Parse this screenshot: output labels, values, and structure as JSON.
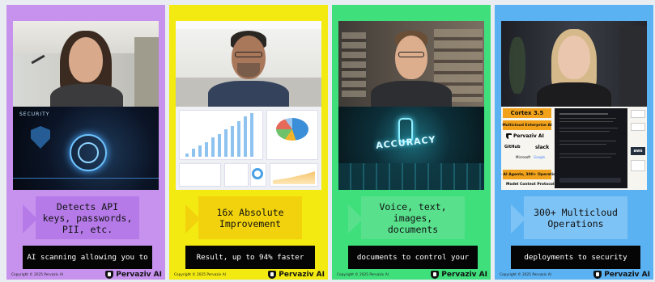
{
  "panels": [
    {
      "caption": "Detects API keys, passwords, PII, etc.",
      "subtitle": "AI scanning allowing you to",
      "visual_text": "SECURITY",
      "accent": "#c792ee",
      "box": "#b57ae8"
    },
    {
      "caption": "16x Absolute Improvement",
      "subtitle": "Result, up to 94% faster",
      "accent": "#f2ea10",
      "box": "#f2d20c"
    },
    {
      "caption": "Voice, text, images, documents",
      "subtitle": "documents to control your",
      "visual_text": "ACCURACY",
      "accent": "#3fe07c",
      "box": "#58e08d"
    },
    {
      "caption": "300+ Multicloud Operations",
      "subtitle": "deployments to security",
      "accent": "#5bb2f2",
      "box": "#7ec3f5",
      "slide": {
        "title": "Cortex 3.5",
        "subtitle": "Multicloud Enterprise AI",
        "brand": "Pervaziv AI",
        "logos": [
          "GitHub",
          "slack",
          "Microsoft",
          "aws",
          "Google"
        ],
        "bottom": "40+ AI Agents, 300+ Operations",
        "bottom2": "Model Context Protocol"
      }
    }
  ],
  "footer": {
    "copyright": "Copyright © 2025 Pervaziv AI",
    "brand": "Pervaziv AI"
  }
}
